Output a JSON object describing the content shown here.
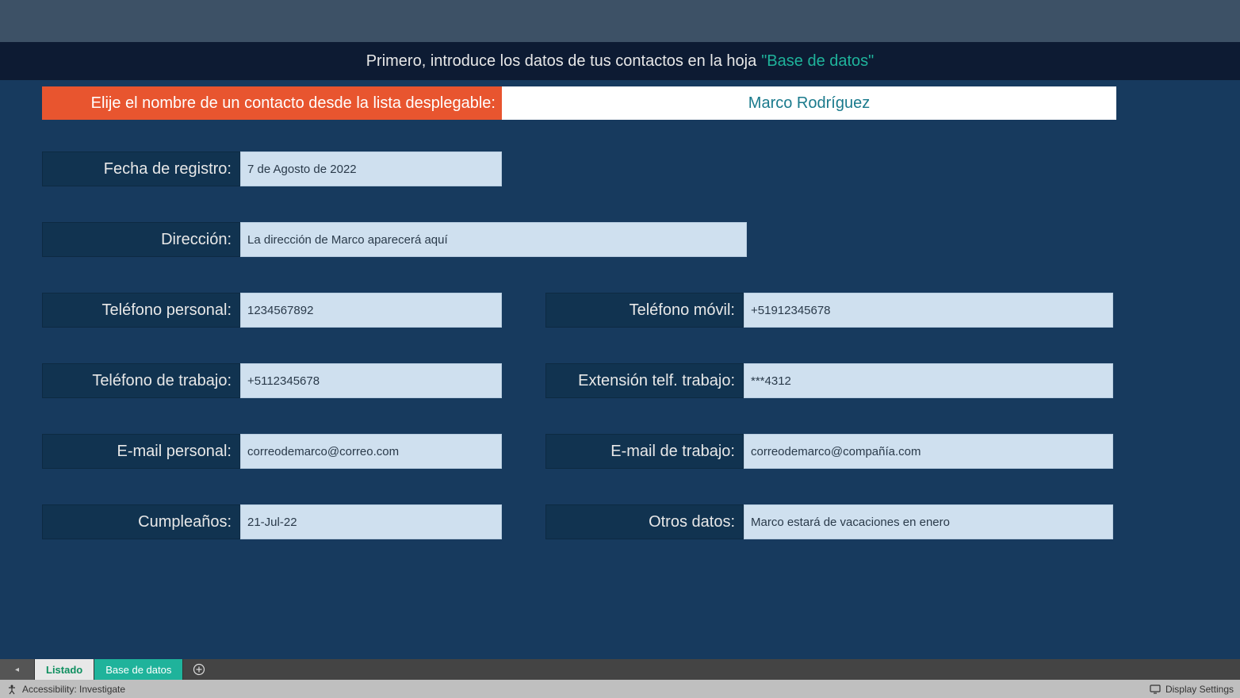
{
  "banner": {
    "prefix": "Primero, introduce los datos de tus contactos en la hoja ",
    "highlight": "\"Base de datos\""
  },
  "selector": {
    "label": "Elije el nombre de un contacto desde la lista desplegable:",
    "value": "Marco Rodríguez"
  },
  "fields": {
    "registro": {
      "label": "Fecha de registro:",
      "value": "7 de Agosto de 2022"
    },
    "direccion": {
      "label": "Dirección:",
      "value": "La dirección de Marco aparecerá aquí"
    },
    "tel_personal": {
      "label": "Teléfono personal:",
      "value": "1234567892"
    },
    "tel_movil": {
      "label": "Teléfono móvil:",
      "value": "+51912345678"
    },
    "tel_trabajo": {
      "label": "Teléfono de trabajo:",
      "value": "+5112345678"
    },
    "ext_trabajo": {
      "label": "Extensión telf. trabajo:",
      "value": "***4312"
    },
    "email_personal": {
      "label": "E-mail personal:",
      "value": "correodemarco@correo.com"
    },
    "email_trabajo": {
      "label": "E-mail de trabajo:",
      "value": "correodemarco@compañía.com"
    },
    "cumple": {
      "label": "Cumpleaños:",
      "value": "21-Jul-22"
    },
    "otros": {
      "label": "Otros datos:",
      "value": "Marco estará de vacaciones en enero"
    }
  },
  "tabs": {
    "active": "Listado",
    "inactive": "Base de datos"
  },
  "status": {
    "accessibility": "Accessibility: Investigate",
    "display": "Display Settings"
  }
}
